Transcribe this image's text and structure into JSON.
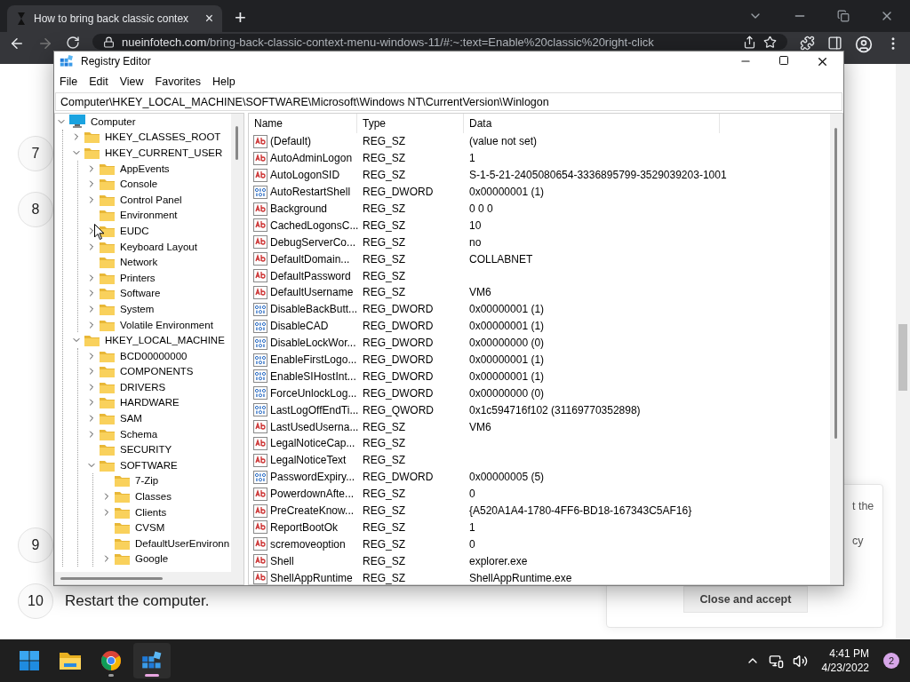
{
  "browser": {
    "tab": {
      "title": "How to bring back classic contex",
      "close": "×"
    },
    "new_tab": "+",
    "url_host": "nueinfotech.com",
    "url_path": "/bring-back-classic-context-menu-windows-11/#:~:text=Enable%20classic%20right-click"
  },
  "page": {
    "steps": [
      {
        "number": "7"
      },
      {
        "number": "8"
      },
      {
        "number": "9"
      },
      {
        "number": "10",
        "text": "Restart the computer."
      }
    ],
    "consent": {
      "lines": [
        "t the",
        "cy"
      ],
      "button": "Close and accept"
    }
  },
  "regedit": {
    "title": "Registry Editor",
    "menu": [
      "File",
      "Edit",
      "View",
      "Favorites",
      "Help"
    ],
    "address": "Computer\\HKEY_LOCAL_MACHINE\\SOFTWARE\\Microsoft\\Windows NT\\CurrentVersion\\Winlogon",
    "tree": {
      "label": "Computer",
      "kind": "computer",
      "expanded": true,
      "children": [
        {
          "label": "HKEY_CLASSES_ROOT",
          "expanded": false
        },
        {
          "label": "HKEY_CURRENT_USER",
          "expanded": true,
          "children": [
            {
              "label": "AppEvents",
              "expanded": false
            },
            {
              "label": "Console",
              "expanded": false
            },
            {
              "label": "Control Panel",
              "expanded": false
            },
            {
              "label": "Environment"
            },
            {
              "label": "EUDC",
              "expanded": false
            },
            {
              "label": "Keyboard Layout",
              "expanded": false
            },
            {
              "label": "Network"
            },
            {
              "label": "Printers",
              "expanded": false
            },
            {
              "label": "Software",
              "expanded": false
            },
            {
              "label": "System",
              "expanded": false
            },
            {
              "label": "Volatile Environment",
              "expanded": false
            }
          ]
        },
        {
          "label": "HKEY_LOCAL_MACHINE",
          "expanded": true,
          "children": [
            {
              "label": "BCD00000000",
              "expanded": false
            },
            {
              "label": "COMPONENTS",
              "expanded": false
            },
            {
              "label": "DRIVERS",
              "expanded": false
            },
            {
              "label": "HARDWARE",
              "expanded": false
            },
            {
              "label": "SAM",
              "expanded": false
            },
            {
              "label": "Schema",
              "expanded": false
            },
            {
              "label": "SECURITY"
            },
            {
              "label": "SOFTWARE",
              "expanded": true,
              "children": [
                {
                  "label": "7-Zip"
                },
                {
                  "label": "Classes",
                  "expanded": false
                },
                {
                  "label": "Clients",
                  "expanded": false
                },
                {
                  "label": "CVSM"
                },
                {
                  "label": "DefaultUserEnvironn"
                },
                {
                  "label": "Google",
                  "expanded": false
                }
              ]
            }
          ]
        }
      ]
    },
    "columns": [
      "Name",
      "Type",
      "Data"
    ],
    "values": [
      {
        "kind": "string",
        "name": "(Default)",
        "type": "REG_SZ",
        "data": "(value not set)"
      },
      {
        "kind": "string",
        "name": "AutoAdminLogon",
        "type": "REG_SZ",
        "data": "1"
      },
      {
        "kind": "string",
        "name": "AutoLogonSID",
        "type": "REG_SZ",
        "data": "S-1-5-21-2405080654-3336895799-3529039203-1001"
      },
      {
        "kind": "binary",
        "name": "AutoRestartShell",
        "type": "REG_DWORD",
        "data": "0x00000001 (1)"
      },
      {
        "kind": "string",
        "name": "Background",
        "type": "REG_SZ",
        "data": "0 0 0"
      },
      {
        "kind": "string",
        "name": "CachedLogonsC...",
        "type": "REG_SZ",
        "data": "10"
      },
      {
        "kind": "string",
        "name": "DebugServerCo...",
        "type": "REG_SZ",
        "data": "no"
      },
      {
        "kind": "string",
        "name": "DefaultDomain...",
        "type": "REG_SZ",
        "data": "COLLABNET"
      },
      {
        "kind": "string",
        "name": "DefaultPassword",
        "type": "REG_SZ"
      },
      {
        "kind": "string",
        "name": "DefaultUsername",
        "type": "REG_SZ",
        "data": "VM6"
      },
      {
        "kind": "binary",
        "name": "DisableBackButt...",
        "type": "REG_DWORD",
        "data": "0x00000001 (1)"
      },
      {
        "kind": "binary",
        "name": "DisableCAD",
        "type": "REG_DWORD",
        "data": "0x00000001 (1)"
      },
      {
        "kind": "binary",
        "name": "DisableLockWor...",
        "type": "REG_DWORD",
        "data": "0x00000000 (0)"
      },
      {
        "kind": "binary",
        "name": "EnableFirstLogo...",
        "type": "REG_DWORD",
        "data": "0x00000001 (1)"
      },
      {
        "kind": "binary",
        "name": "EnableSIHostInt...",
        "type": "REG_DWORD",
        "data": "0x00000001 (1)"
      },
      {
        "kind": "binary",
        "name": "ForceUnlockLog...",
        "type": "REG_DWORD",
        "data": "0x00000000 (0)"
      },
      {
        "kind": "binary",
        "name": "LastLogOffEndTi...",
        "type": "REG_QWORD",
        "data": "0x1c594716f102 (31169770352898)"
      },
      {
        "kind": "string",
        "name": "LastUsedUserna...",
        "type": "REG_SZ",
        "data": "VM6"
      },
      {
        "kind": "string",
        "name": "LegalNoticeCap...",
        "type": "REG_SZ"
      },
      {
        "kind": "string",
        "name": "LegalNoticeText",
        "type": "REG_SZ"
      },
      {
        "kind": "binary",
        "name": "PasswordExpiry...",
        "type": "REG_DWORD",
        "data": "0x00000005 (5)"
      },
      {
        "kind": "string",
        "name": "PowerdownAfte...",
        "type": "REG_SZ",
        "data": "0"
      },
      {
        "kind": "string",
        "name": "PreCreateKnow...",
        "type": "REG_SZ",
        "data": "{A520A1A4-1780-4FF6-BD18-167343C5AF16}"
      },
      {
        "kind": "string",
        "name": "ReportBootOk",
        "type": "REG_SZ",
        "data": "1"
      },
      {
        "kind": "string",
        "name": "scremoveoption",
        "type": "REG_SZ",
        "data": "0"
      },
      {
        "kind": "string",
        "name": "Shell",
        "type": "REG_SZ",
        "data": "explorer.exe"
      },
      {
        "kind": "string",
        "name": "ShellAppRuntime",
        "type": "REG_SZ",
        "data": "ShellAppRuntime.exe"
      }
    ]
  },
  "taskbar": {
    "apps": [
      {
        "kind": "start",
        "running": false,
        "selected": false
      },
      {
        "kind": "explorer",
        "running": false,
        "selected": false
      },
      {
        "kind": "chrome",
        "running": true,
        "selected": false
      },
      {
        "kind": "regedit",
        "running": true,
        "selected": true
      }
    ],
    "time": "4:41 PM",
    "date": "4/23/2022",
    "badge": "2"
  }
}
